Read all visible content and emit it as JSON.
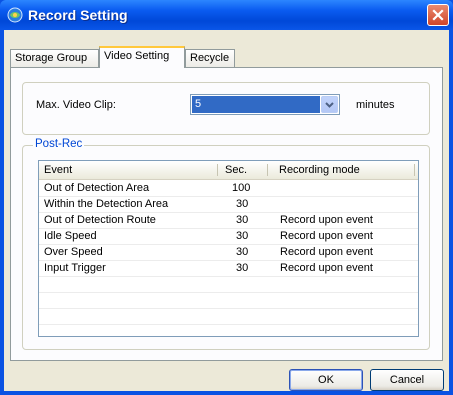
{
  "window": {
    "title": "Record Setting"
  },
  "tabs": [
    {
      "label": "Storage Group",
      "active": false
    },
    {
      "label": "Video Setting",
      "active": true
    },
    {
      "label": "Recycle",
      "active": false
    }
  ],
  "video": {
    "max_clip_label": "Max. Video Clip:",
    "max_clip_value": "5",
    "minutes_label": "minutes"
  },
  "postrec": {
    "legend": "Post-Rec",
    "columns": [
      "Event",
      "Sec.",
      "Recording mode"
    ],
    "rows": [
      {
        "event": "Out of Detection Area",
        "sec": "100",
        "mode": ""
      },
      {
        "event": "Within the Detection Area",
        "sec": "30",
        "mode": ""
      },
      {
        "event": "Out of Detection Route",
        "sec": "30",
        "mode": "Record upon event"
      },
      {
        "event": "Idle Speed",
        "sec": "30",
        "mode": "Record upon event"
      },
      {
        "event": "Over Speed",
        "sec": "30",
        "mode": "Record upon event"
      },
      {
        "event": "Input Trigger",
        "sec": "30",
        "mode": "Record upon event"
      }
    ]
  },
  "buttons": {
    "ok": "OK",
    "cancel": "Cancel"
  },
  "colors": {
    "titlebar": "#0a5bf0",
    "selection": "#316ac5",
    "group_legend": "#0046d5",
    "close_button": "#d0452a"
  }
}
